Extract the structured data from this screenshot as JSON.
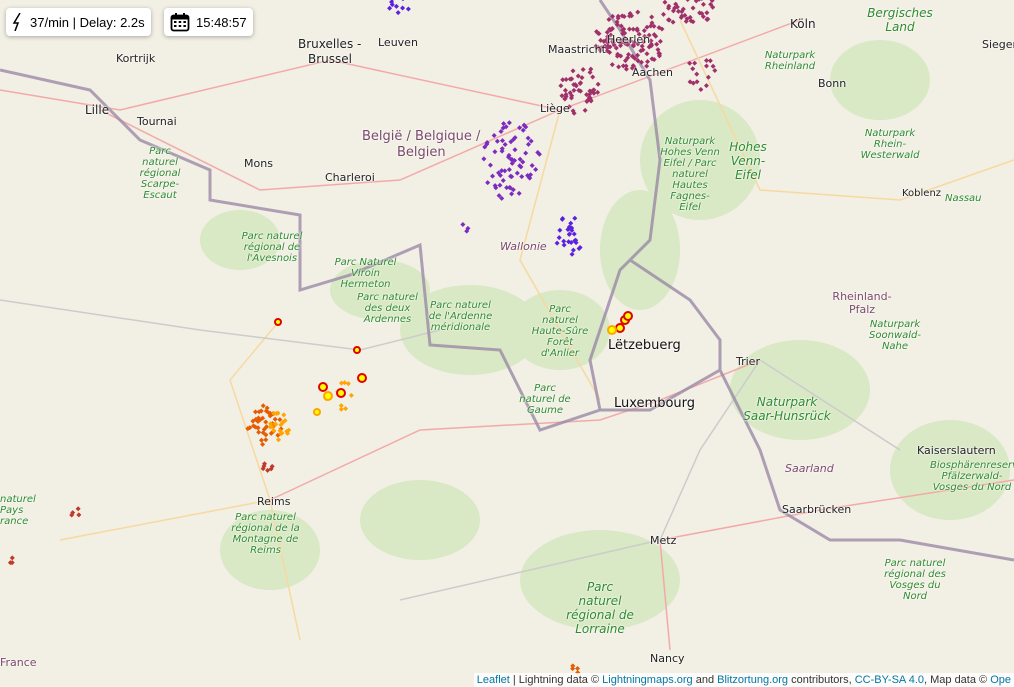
{
  "controls": {
    "rate": "37/min | Delay: 2.2s",
    "time": "15:48:57",
    "rate_icon": "lightning-icon",
    "time_icon": "calendar-icon"
  },
  "strike_colors": {
    "newest": "#ffff00",
    "new": "#ffa500",
    "mid": "#e65c00",
    "older": "#c0392b",
    "old": "#a0306a",
    "oldest": "#7b2cbf",
    "ancient": "#5b21e0"
  },
  "labels": {
    "bruxelles": "Bruxelles -",
    "brussel": "Brussel",
    "leuven": "Leuven",
    "kortrijk": "Kortrijk",
    "lille": "Lille",
    "tournai": "Tournai",
    "mons": "Mons",
    "charleroi": "Charleroi",
    "maastricht": "Maastricht",
    "heerlen": "Heerlen",
    "aachen": "Aachen",
    "koln": "Köln",
    "bergisches": "Bergisches Land",
    "siegen": "Siegen",
    "bonn": "Bonn",
    "np_rheinland": "Naturpark Rheinland",
    "belgie": "België / Belgique /",
    "belgien": "Belgien",
    "liege": "Liège",
    "np_venn": "Naturpark Hohes Venn Eifel / Parc naturel Hautes Fagnes-Eifel",
    "hohes_venn": "Hohes Venn-Eifel",
    "np_rhein_westerwald": "Naturpark Rhein-Westerwald",
    "koblenz": "Koblenz",
    "nassau": "Nassau",
    "wallonie": "Wallonie",
    "pnr_scarpe": "Parc naturel régional Scarpe-Escaut",
    "pnr_avesnois": "Parc naturel régional de l'Avesnois",
    "pn_viroin": "Parc Naturel Viroin Hermeton",
    "pn_ardennes": "Parc naturel des deux Ardennes",
    "pn_ardenne_merid": "Parc naturel de l'Ardenne méridionale",
    "pn_haute_sure": "Parc naturel Haute-Sûre Forêt d'Anlier",
    "letzebuerg": "Lëtzebuerg",
    "luxembourg": "Luxembourg",
    "pn_gaume": "Parc naturel de Gaume",
    "rheinland_pfalz": "Rheinland-Pfalz",
    "np_soonwald": "Naturpark Soonwald-Nahe",
    "trier": "Trier",
    "np_saar": "Naturpark Saar-Hunsrück",
    "saarland": "Saarland",
    "kaiserslautern": "Kaiserslautern",
    "biosphere": "Biosphärenreservat Pfälzerwald-Vosges du Nord",
    "saarbrucken": "Saarbrücken",
    "metz": "Metz",
    "pnr_vosges": "Parc naturel régional des Vosges du Nord",
    "pnr_lorraine": "Parc naturel régional de Lorraine",
    "nancy": "Nancy",
    "reims": "Reims",
    "pnr_reims": "Parc naturel régional de la Montagne de Reims",
    "pnr_pays": "naturel Pays rance",
    "france": "France"
  },
  "attribution": {
    "leaflet": "Leaflet",
    "sep": " | Lightning data © ",
    "lightningmaps": "Lightningmaps.org",
    "and": " and ",
    "blitzortung": "Blitzortung.org",
    "contributors": " contributors, ",
    "license": "CC-BY-SA 4.0",
    "mapdata": ", Map data © ",
    "osm": "Ope"
  }
}
